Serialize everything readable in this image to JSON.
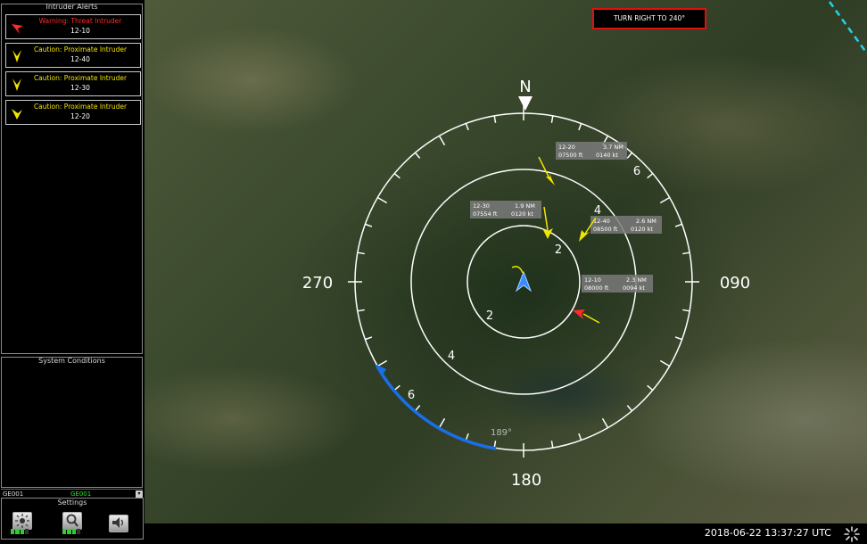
{
  "sidebar": {
    "intruder_title": "Intruder Alerts",
    "alerts": [
      {
        "level": "warning",
        "label": "Warning: Threat Intruder",
        "id": "12-10",
        "color": "#ff2a2a"
      },
      {
        "level": "caution",
        "label": "Caution: Proximate Intruder",
        "id": "12-40",
        "color": "#f2e600"
      },
      {
        "level": "caution",
        "label": "Caution: Proximate Intruder",
        "id": "12-30",
        "color": "#f2e600"
      },
      {
        "level": "caution",
        "label": "Caution: Proximate Intruder",
        "id": "12-20",
        "color": "#f2e600"
      }
    ],
    "system_title": "System Conditions",
    "selector_left": "GE001",
    "selector_right": "GE001",
    "settings_title": "Settings",
    "settings_icons": [
      "brightness-icon",
      "zoom-icon",
      "speaker-icon"
    ]
  },
  "resolution": "TURN RIGHT TO 240°",
  "compass": {
    "north": "N",
    "east": "090",
    "south": "180",
    "west": "270",
    "ring_labels_ne": [
      "2",
      "4",
      "6"
    ],
    "ring_labels_sw": [
      "2",
      "4",
      "6"
    ],
    "heading_bug": "189°"
  },
  "intruders": [
    {
      "id": "12-20",
      "range": "3.7 NM",
      "alt": "07500 ft",
      "speed": "0140 kt",
      "color": "#f2e600"
    },
    {
      "id": "12-30",
      "range": "1.9 NM",
      "alt": "07554 ft",
      "speed": "0120 kt",
      "color": "#f2e600"
    },
    {
      "id": "12-40",
      "range": "2.6 NM",
      "alt": "08500 ft",
      "speed": "0120 kt",
      "color": "#f2e600"
    },
    {
      "id": "12-10",
      "range": "2.3 NM",
      "alt": "08000 ft",
      "speed": "0094 kt",
      "color": "#ff2a2a"
    }
  ],
  "status": {
    "timestamp": "2018-06-22 13:37:27 UTC"
  }
}
